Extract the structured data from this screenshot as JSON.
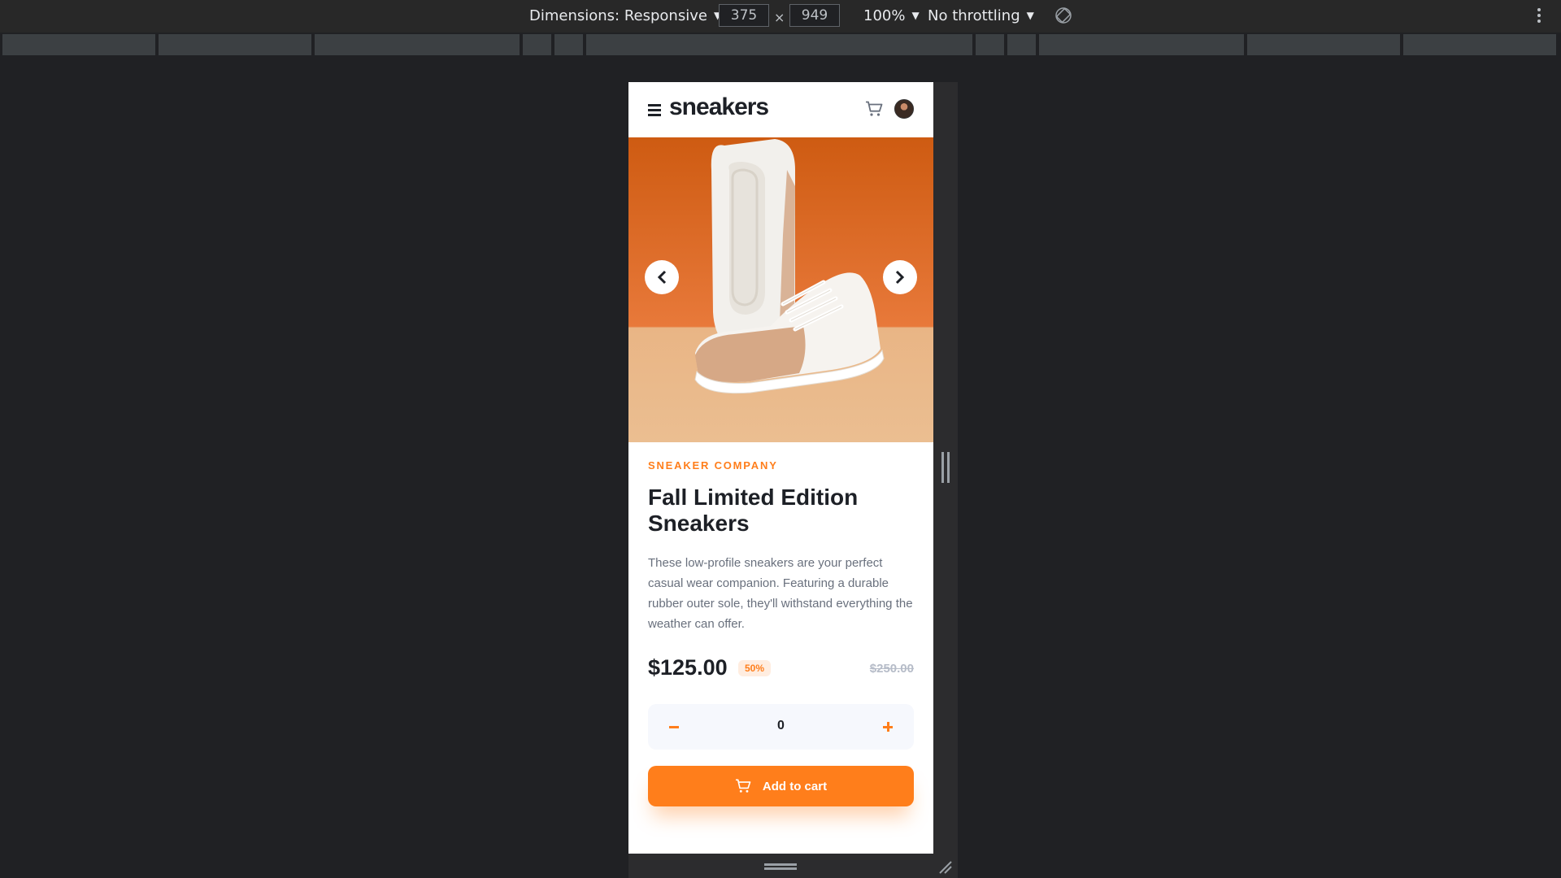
{
  "devtools": {
    "dimensions_label": "Dimensions: Responsive",
    "width_value": "375",
    "height_value": "949",
    "times_sign": "×",
    "zoom": "100%",
    "throttling": "No throttling"
  },
  "header": {
    "logo": "sneakers"
  },
  "product": {
    "company": "SNEAKER COMPANY",
    "title": "Fall Limited Edition Sneakers",
    "description": "These low-profile sneakers are your perfect casual wear companion. Featuring a durable rubber outer sole, they'll withstand everything the weather can offer.",
    "price": "$125.00",
    "discount": "50%",
    "original_price": "$250.00",
    "quantity": "0",
    "add_to_cart": "Add to cart"
  },
  "colors": {
    "accent": "#ff7e1b",
    "text_dark": "#1d2026",
    "text_muted": "#69707d"
  },
  "icons": [
    "menu-icon",
    "cart-icon",
    "avatar",
    "chevron-left-icon",
    "chevron-right-icon",
    "minus-icon",
    "plus-icon",
    "rotate-icon",
    "kebab-icon"
  ]
}
